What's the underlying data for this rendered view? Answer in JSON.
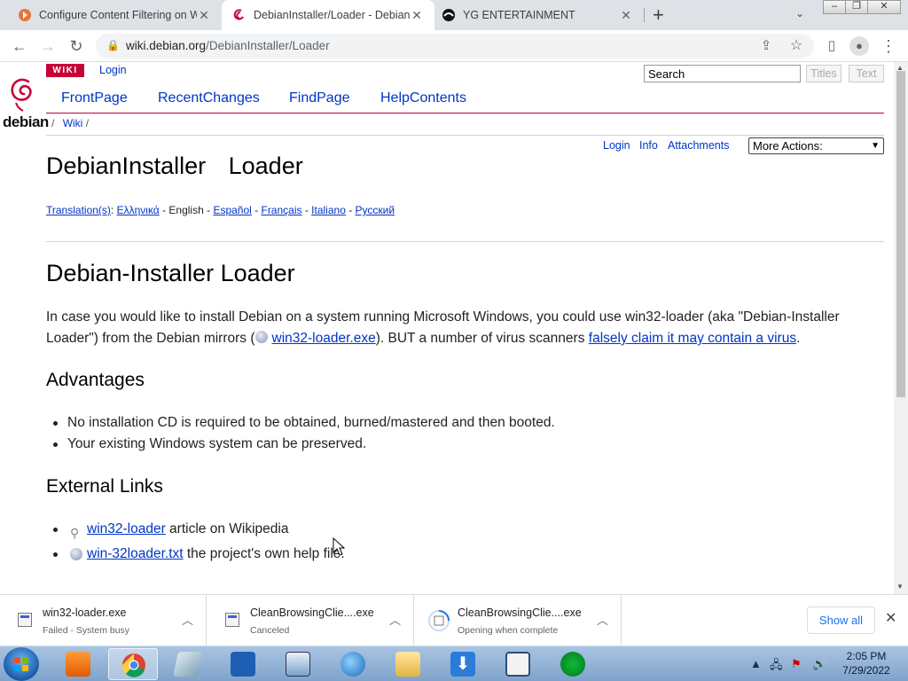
{
  "browser": {
    "tabs": [
      {
        "title": "Configure Content Filtering on W",
        "favicon_color": "#e8743b",
        "active": false
      },
      {
        "title": "DebianInstaller/Loader - Debian",
        "favicon_color": "#c70036",
        "active": true
      },
      {
        "title": "YG ENTERTAINMENT",
        "favicon_color": "#111111",
        "active": false
      }
    ],
    "url_host": "wiki.debian.org",
    "url_path": "/DebianInstaller/Loader"
  },
  "wiki": {
    "logo_text": "debian",
    "badge": "WIKI",
    "login": "Login",
    "search_value": "Search",
    "search_titles": "Titles",
    "search_text": "Text",
    "nav": [
      "FrontPage",
      "RecentChanges",
      "FindPage",
      "HelpContents"
    ],
    "breadcrumb_sep": "/",
    "breadcrumb_wiki": "Wiki",
    "breadcrumb_tail": "/",
    "actions": [
      "Login",
      "Info",
      "Attachments"
    ],
    "more_actions": "More Actions:",
    "colors": {
      "link": "#0035c7",
      "accent": "#c70036"
    }
  },
  "page": {
    "title_part1": "DebianInstaller",
    "title_part2": "Loader",
    "translations_label": "Translation(s)",
    "translations": {
      "greek": "Ελληνικά",
      "sep1": " - ",
      "english": "English",
      "sep2": " - ",
      "spanish": "Español",
      "sep3": " - ",
      "french": "Français",
      "sep4": " - ",
      "italian": "Italiano",
      "sep5": " - ",
      "russian": "Русский"
    },
    "heading": "Debian-Installer Loader",
    "intro_1": "In case you would like to install Debian on a system running Microsoft Windows, you could use win32-loader (aka \"Debian-Installer Loader\") from the Debian mirrors (",
    "intro_link1": "win32-loader.exe",
    "intro_2": "). BUT a number of virus scanners ",
    "intro_link2": "falsely claim it may contain a virus",
    "intro_3": ".",
    "advantages_heading": "Advantages",
    "advantages": [
      "No installation CD is required to be obtained, burned/mastered and then booted.",
      "Your existing Windows system can be preserved."
    ],
    "external_heading": "External Links",
    "external": [
      {
        "link": "win32-loader",
        "rest": " article on Wikipedia"
      },
      {
        "link": "win-32loader.txt",
        "rest": " the project's own help file."
      }
    ]
  },
  "downloads": {
    "items": [
      {
        "name": "win32-loader.exe",
        "status": "Failed - System busy"
      },
      {
        "name": "CleanBrowsingClie....exe",
        "status": "Canceled"
      },
      {
        "name": "CleanBrowsingClie....exe",
        "status": "Opening when complete"
      }
    ],
    "show_all": "Show all"
  },
  "taskbar": {
    "time": "2:05 PM",
    "date": "7/29/2022"
  }
}
